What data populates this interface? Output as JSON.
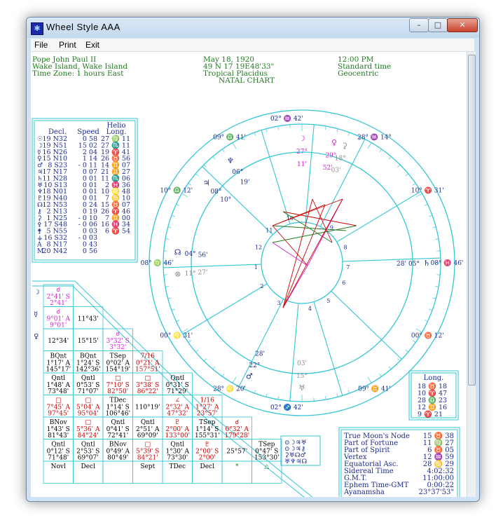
{
  "window": {
    "title": "Wheel  Style  AAA",
    "minimize": "–",
    "maximize": "□",
    "close": "✕"
  },
  "menu": [
    "File",
    "Print",
    "Exit"
  ],
  "header": {
    "name": "Pope John Paul II",
    "place": "Wake Island, Wake Island",
    "tz": "Time Zone: 1 hours East",
    "date": "May 18, 1920",
    "coords": "49 N 17  19E48'33\"",
    "system": "Tropical Placidus",
    "chart": "NATAL CHART",
    "time": "12:00 PM",
    "timetype": "Standard time",
    "centric": "Geocentric"
  },
  "planet_table": {
    "headers": [
      "Decl.",
      "Speed",
      "Helio",
      "Long."
    ],
    "rows": [
      [
        "☉",
        "19 N32",
        "0 58",
        "27 ♍ 11"
      ],
      [
        "☽",
        "19 N51",
        "15 02",
        "27 ♏ 11"
      ],
      [
        "☿",
        "16 N26",
        "2 04",
        "19 ♈ 41"
      ],
      [
        "♀",
        "15 N10",
        "1 14",
        "26 ♉ 56"
      ],
      [
        "♂",
        "8 S23",
        "- 0 11",
        "14 ♊ 07"
      ],
      [
        "♃",
        "17 N17",
        "0 07",
        "21 ♊ 27"
      ],
      [
        "♄",
        "11 N28",
        "0 01",
        "11 ♏ 06"
      ],
      [
        "♅",
        "10 S13",
        "0 01",
        "2 ♓ 36"
      ],
      [
        "♆",
        "18 N01",
        "0 01",
        "10 ♌ 48"
      ],
      [
        "♇",
        "19 N40",
        "0 01",
        "7 ♋ 10"
      ],
      [
        "☊",
        "12 N53",
        "0 24",
        "15 ♉ 07"
      ],
      [
        "⚷",
        "2 N13",
        "0 19",
        "26 ♈ 46"
      ],
      [
        "⚳",
        "1 N25",
        "- 0 10",
        "7 ♊ 00"
      ],
      [
        "⚴",
        "17 S48",
        "- 0 06",
        "16 ♓ 34"
      ],
      [
        "⚵",
        "5 N55",
        "0 03",
        "6 ♈ 54"
      ],
      [
        "⚶",
        "16 S32",
        "- 0 03",
        ""
      ],
      [
        "A",
        "8 N17",
        "0 43",
        ""
      ],
      [
        "M",
        "20 N42",
        "0 56",
        ""
      ]
    ]
  },
  "wheel": {
    "cusps_outer": [
      {
        "deg": "02°",
        "sign": "♒",
        "min": "42'"
      },
      {
        "deg": "28°",
        "sign": "♒",
        "min": "14°"
      },
      {
        "deg": "10°",
        "sign": "♈",
        "min": "31'"
      },
      {
        "deg": "08°",
        "sign": "♓",
        "min": "46'"
      },
      {
        "deg": "00°",
        "sign": "♉",
        "min": "12'"
      },
      {
        "deg": "09°",
        "sign": "♊",
        "min": "41'"
      },
      {
        "deg": "02°",
        "sign": "♐",
        "min": "42'"
      },
      {
        "deg": "28°",
        "sign": "♌",
        "min": "20'"
      },
      {
        "deg": "00°",
        "sign": "♌",
        "min": "31'"
      },
      {
        "deg": "08°",
        "sign": "♍",
        "min": "46'"
      },
      {
        "deg": "10°",
        "sign": "♎",
        "min": "12'"
      },
      {
        "deg": "09°",
        "sign": "♎",
        "min": "41'"
      }
    ],
    "planets": [
      {
        "g": "♆",
        "deg": "06°",
        "min": "19'"
      },
      {
        "g": "♃",
        "deg": "08°",
        "min": "10°"
      },
      {
        "g": "♀",
        "deg": "29°",
        "min": "52'"
      },
      {
        "g": "☽",
        "deg": "27°",
        "min": "11'"
      },
      {
        "g": "⚳",
        "deg": "18°",
        "min": "03'"
      },
      {
        "g": "♄",
        "deg": "05°",
        "min": "28'"
      },
      {
        "g": "♂",
        "deg": "22°",
        "min": "28'"
      },
      {
        "g": "♅",
        "deg": "15°",
        "min": "03'"
      },
      {
        "g": "⊗",
        "deg": "11°",
        "min": "27'"
      },
      {
        "g": "☊",
        "deg": "04°",
        "min": "56'"
      }
    ],
    "house_numbers": [
      "10",
      "11",
      "12",
      "1",
      "2",
      "3",
      "4",
      "5",
      "6",
      "7",
      "8",
      "9"
    ]
  },
  "aspect_grid": {
    "rows": [
      {
        "label": "☽",
        "cells": [
          [
            "☌",
            "2°41' S",
            "2°41'"
          ]
        ]
      },
      {
        "label": "☿",
        "cells": [
          [
            "☌",
            "9°01' A",
            "9°01'"
          ],
          [
            "",
            "11°43'",
            ""
          ]
        ]
      },
      {
        "label": "♀",
        "cells": [
          [
            "",
            "12°34'",
            ""
          ],
          [
            "",
            "15°15'",
            ""
          ],
          [
            "☌",
            "3°32' S",
            "3°32'"
          ]
        ]
      },
      {
        "label": "",
        "cells": [
          [
            "BQnt",
            "1°17' A",
            "145°17'"
          ],
          [
            "BQnt",
            "1°24' S",
            "142°36'"
          ],
          [
            "TSep",
            "0°02' A",
            "154°19'"
          ],
          [
            "7/16",
            "0°21' A",
            "157°51'"
          ]
        ]
      },
      {
        "label": "",
        "cells": [
          [
            "Qntl",
            "1°48' A",
            "73°48'"
          ],
          [
            "Qntl",
            "0°53' S",
            "71°07'"
          ],
          [
            "□",
            "7°10' S",
            "82°50'"
          ],
          [
            "□",
            "3°38' S",
            "86°22'"
          ],
          [
            "Qntl",
            "0°31' S",
            "71°29'"
          ]
        ]
      },
      {
        "label": "",
        "cells": [
          [
            "□",
            "7°45' A",
            "97°45'"
          ],
          [
            "□",
            "5°04' A",
            "95°04'"
          ],
          [
            "TDec",
            "1°14' S",
            "106°46'"
          ],
          [
            "",
            "110°19'",
            ""
          ],
          [
            "∠",
            "2°32' A",
            "47°32'"
          ],
          [
            "1/16",
            "1°27' A",
            "23°57'"
          ]
        ]
      },
      {
        "label": "",
        "cells": [
          [
            "BNov",
            "1°43' S",
            "81°43'"
          ],
          [
            "□",
            "5°36' A",
            "84°24'"
          ],
          [
            "Qntl",
            "0°41' S",
            "72°41'"
          ],
          [
            "Qntl",
            "2°51' A",
            "69°09'"
          ],
          [
            "♇",
            "2°00' A",
            "133°00'"
          ],
          [
            "TSep",
            "1°14' S",
            "155°31'"
          ],
          [
            "☌",
            "0°32' A",
            "179°28'"
          ]
        ]
      },
      {
        "label": "",
        "cells": [
          [
            "Qntl",
            "0°12' S",
            "71°48'"
          ],
          [
            "Qntl",
            "2°53' S",
            "69°07'"
          ],
          [
            "BNov",
            "0°49' A",
            "80°49'"
          ],
          [
            "□",
            "5°39' S",
            "84°21'"
          ],
          [
            "Qntl",
            "1°30' A",
            "73°30'"
          ],
          [
            "♇",
            "2°00' S",
            "2°00'"
          ],
          [
            "",
            "25°57'",
            ""
          ],
          [
            "TSep",
            "0°47' S",
            "153°30'"
          ]
        ]
      },
      {
        "label": "",
        "cells": [
          [
            "Novl",
            "",
            ""
          ],
          [
            "Decl",
            "",
            ""
          ],
          [
            "",
            "",
            ""
          ],
          [
            "Sept",
            "",
            ""
          ],
          [
            "TDec",
            "",
            ""
          ],
          [
            "Decl",
            "",
            ""
          ],
          [
            "*",
            "",
            ""
          ],
          [
            "△",
            "",
            ""
          ]
        ]
      }
    ]
  },
  "long_box": {
    "title": "Long.",
    "rows": [
      "18 ♉ 18",
      "10 ♈ 47",
      "28 ♎ 23",
      "12 ♊ 16",
      "9 ♈ 21"
    ]
  },
  "info_box": {
    "rows": [
      [
        "True Moon's Node",
        "15 ♉ 38"
      ],
      [
        "Part of Fortune",
        "11 ♍ 27"
      ],
      [
        "Part of Spirit",
        "6 ♉ 05"
      ],
      [
        "Vertex",
        "12 ♒ 59"
      ],
      [
        "Equatorial Asc.",
        "28 ♋ 29"
      ],
      [
        "Sidereal Time",
        "4:02:32"
      ],
      [
        "G.M.T.",
        "11:00:00"
      ],
      [
        "Ephem Time-GMT",
        "0:00:22"
      ],
      [
        "Ayanamsha",
        "23°37'53\""
      ]
    ]
  },
  "glyph_box": [
    "⊙☽♃♅",
    "⊙☽♃⚷",
    "⚳♅☊♂",
    "♅♆♃☊"
  ],
  "colors": {
    "cyan": "#34c6d6",
    "green": "#1f7a1f",
    "blue": "#1a2b8c",
    "magenta": "#d61fd6",
    "red": "#cc0000",
    "gray": "#8a8a8a"
  }
}
